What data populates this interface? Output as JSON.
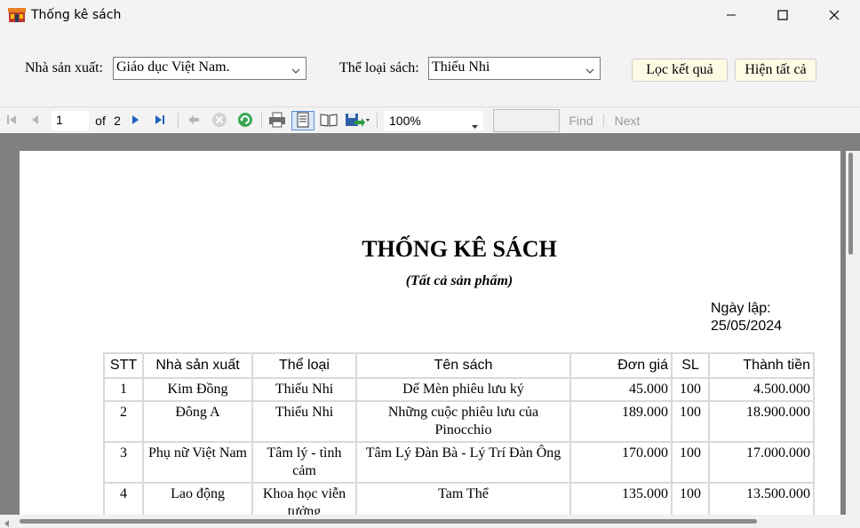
{
  "window": {
    "title": "Thống kê sách"
  },
  "filters": {
    "publisher_label": "Nhà sản xuất:",
    "publisher_value": "Giáo dục Việt Nam.",
    "category_label": "Thể loại sách:",
    "category_value": "Thiếu Nhi",
    "filter_button": "Lọc kết quả",
    "show_all_button": "Hiện tất cả"
  },
  "toolbar": {
    "current_page": "1",
    "of_label": "of",
    "total_pages": "2",
    "zoom": "100%",
    "find_label": "Find",
    "next_label": "Next",
    "find_value": ""
  },
  "report": {
    "title": "THỐNG KÊ SÁCH",
    "subtitle": "(Tất cả sản phẩm)",
    "date_label": "Ngày lập:",
    "date_value": "25/05/2024",
    "headers": {
      "stt": "STT",
      "publisher": "Nhà sản xuất",
      "category": "Thể loại",
      "book": "Tên sách",
      "price": "Đơn giá",
      "qty": "SL",
      "total": "Thành tiền"
    },
    "rows": [
      {
        "stt": "1",
        "publisher": "Kim Đồng",
        "category": "Thiếu Nhi",
        "book": "Dế Mèn phiêu lưu ký",
        "price": "45.000",
        "qty": "100",
        "total": "4.500.000"
      },
      {
        "stt": "2",
        "publisher": "Đông A",
        "category": "Thiếu Nhi",
        "book": "Những cuộc phiêu lưu của Pinocchio",
        "price": "189.000",
        "qty": "100",
        "total": "18.900.000"
      },
      {
        "stt": "3",
        "publisher": "Phụ nữ Việt Nam",
        "category": "Tâm lý - tình cảm",
        "book": "Tâm Lý Đàn Bà - Lý Trí Đàn Ông",
        "price": "170.000",
        "qty": "100",
        "total": "17.000.000"
      },
      {
        "stt": "4",
        "publisher": "Lao động",
        "category": "Khoa học viễn tưởng",
        "book": "Tam Thể",
        "price": "135.000",
        "qty": "100",
        "total": "13.500.000"
      }
    ]
  },
  "icons": {
    "app": "bookshop-icon",
    "first": "first-page-icon",
    "prev": "previous-page-icon",
    "next": "next-page-icon",
    "last": "last-page-icon",
    "back": "back-icon",
    "stop": "stop-icon",
    "refresh": "refresh-icon",
    "print": "print-icon",
    "print_layout": "print-layout-icon",
    "page_setup": "page-setup-icon",
    "export": "export-icon"
  },
  "colors": {
    "button_bg": "#fdfbe4",
    "viewer_bg": "#808080",
    "grid": "#d9d9d9",
    "accent": "#1f5fbf"
  }
}
